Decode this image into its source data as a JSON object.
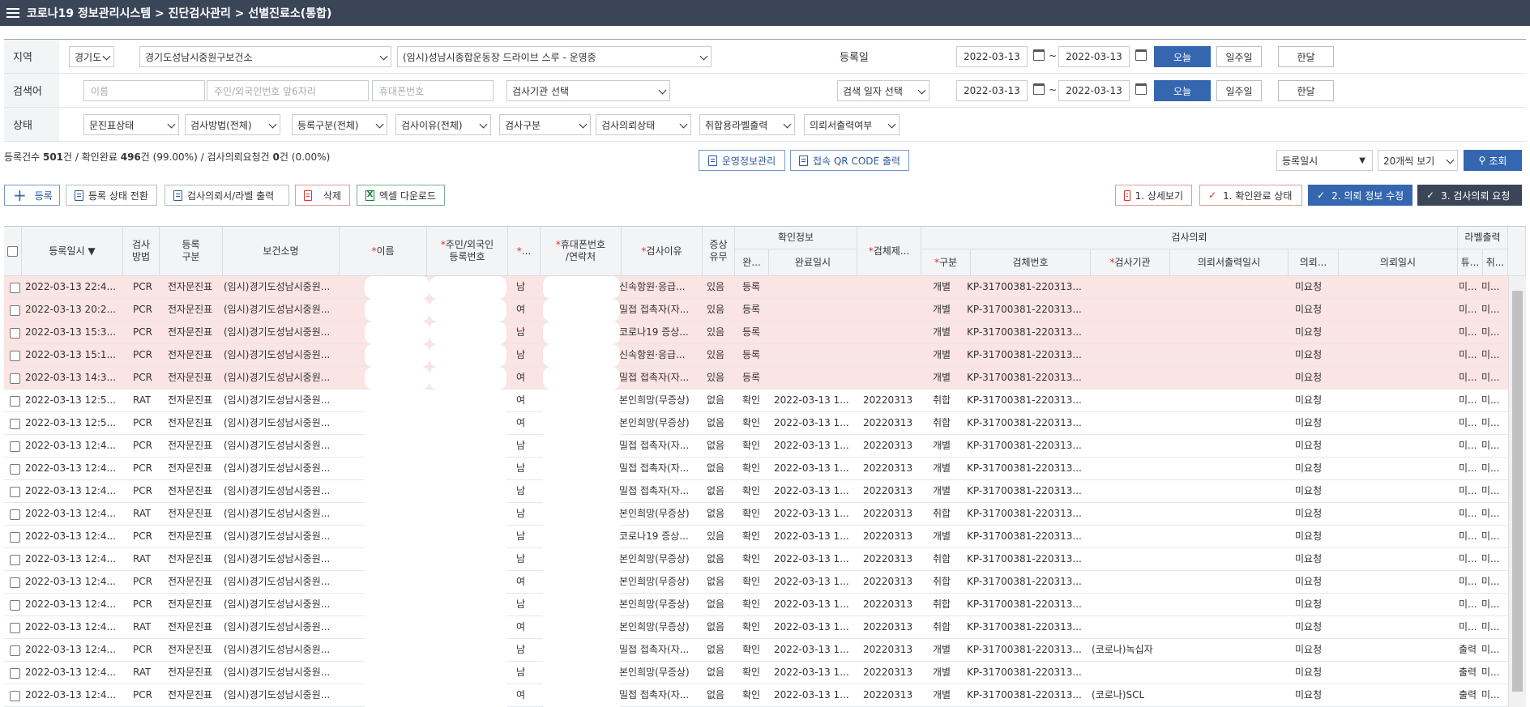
{
  "header": {
    "title": "코로나19 정보관리시스템 > 진단검사관리 > 선별진료소(통합)"
  },
  "filters": {
    "region_label": "지역",
    "province": "경기도",
    "health_center": "경기도성남시중원구보건소",
    "clinic": "(임시)성남시종합운동장 드라이브 스루 - 운영중",
    "reg_date_label": "등록일",
    "reg_date_from": "2022-03-13",
    "reg_date_to": "2022-03-13",
    "today": "오늘",
    "week": "일주일",
    "month": "한달",
    "search_label": "검색어",
    "name_placeholder": "이름",
    "id_placeholder": "주민/외국인번호 앞6자리",
    "phone_placeholder": "휴대폰번호",
    "lab_select": "검사기관 선택",
    "search_date_select": "검색 일자 선택",
    "search_date_from": "2022-03-13",
    "search_date_to": "2022-03-13",
    "status_label": "상태",
    "status_selects": [
      "문진표상태",
      "검사방법(전체)",
      "등록구분(전체)",
      "검사이유(전체)",
      "검사구분",
      "검사의뢰상태",
      "취합용라벨출력",
      "의뢰서출력여부"
    ]
  },
  "summary": {
    "p1": "등록건수 ",
    "reg_count": "501",
    "p2": "건 / 확인완료 ",
    "confirmed": "496",
    "p3": "건 (99.00%) / 검사의뢰요청건 ",
    "requested": "0",
    "p4": "건 (0.00%)"
  },
  "actions": {
    "ops_info": "운영정보관리",
    "qr_print": "접속 QR CODE 출력",
    "sort_select": "등록일시",
    "page_size_select": "20개씩 보기",
    "search_button": "조회",
    "register": "등록",
    "status_change": "등록 상태 전환",
    "print_label": "검사의뢰서/라벨 출력",
    "delete": "삭제",
    "excel": "엑셀 다운로드",
    "detail": "1. 상세보기",
    "confirm_status": "1. 확인완료 상태",
    "edit_request": "2. 의뢰 정보 수정",
    "request_test": "3. 검사의뢰 요청"
  },
  "table": {
    "group_headers": {
      "confirm": "확인정보",
      "request": "검사의뢰",
      "label": "라벨출력"
    },
    "headers": {
      "reg_time": "등록일시 ▼",
      "method": [
        "검사",
        "방법"
      ],
      "reg_type": [
        "등록",
        "구분"
      ],
      "center": "보건소명",
      "name": "이름",
      "rrn": [
        "주민/외국인",
        "등록번호"
      ],
      "sex": "...",
      "phone": [
        "휴대폰번호",
        "/연락처"
      ],
      "reason": "검사이유",
      "symptom": [
        "증상",
        "유무"
      ],
      "done": "완...",
      "done_time": "완료일시",
      "specimen": "검체제...",
      "type": "구분",
      "specimen_no": "검체번호",
      "lab": "검사기관",
      "print_time": "의뢰서출력일시",
      "req_status": "의뢰...",
      "req_time": "의뢰일시",
      "lbl1": "튜...",
      "lbl2": "취..."
    },
    "rows": [
      {
        "time": "2022-03-13 22:4...",
        "method": "PCR",
        "type": "전자문진표",
        "center": "(임시)경기도성남시중원...",
        "sex": "남",
        "reason": "신속항원·응급...",
        "symptom": "있음",
        "confirm": "등록",
        "done_time": "",
        "specimen": "",
        "group": "개별",
        "spec_no": "KP-31700381-220313...",
        "lab": "",
        "req": "미요청",
        "l1": "미...",
        "l2": "미...",
        "pending": true
      },
      {
        "time": "2022-03-13 20:2...",
        "method": "PCR",
        "type": "전자문진표",
        "center": "(임시)경기도성남시중원...",
        "sex": "여",
        "reason": "밀접 접촉자(자...",
        "symptom": "있음",
        "confirm": "등록",
        "done_time": "",
        "specimen": "",
        "group": "개별",
        "spec_no": "KP-31700381-220313...",
        "lab": "",
        "req": "미요청",
        "l1": "미...",
        "l2": "미...",
        "pending": true
      },
      {
        "time": "2022-03-13 15:3...",
        "method": "PCR",
        "type": "전자문진표",
        "center": "(임시)경기도성남시중원...",
        "sex": "남",
        "reason": "코로나19 증상...",
        "symptom": "있음",
        "confirm": "등록",
        "done_time": "",
        "specimen": "",
        "group": "개별",
        "spec_no": "KP-31700381-220313...",
        "lab": "",
        "req": "미요청",
        "l1": "미...",
        "l2": "미...",
        "pending": true
      },
      {
        "time": "2022-03-13 15:1...",
        "method": "PCR",
        "type": "전자문진표",
        "center": "(임시)경기도성남시중원...",
        "sex": "남",
        "reason": "신속항원·응급...",
        "symptom": "있음",
        "confirm": "등록",
        "done_time": "",
        "specimen": "",
        "group": "개별",
        "spec_no": "KP-31700381-220313...",
        "lab": "",
        "req": "미요청",
        "l1": "미...",
        "l2": "미...",
        "pending": true
      },
      {
        "time": "2022-03-13 14:3...",
        "method": "PCR",
        "type": "전자문진표",
        "center": "(임시)경기도성남시중원...",
        "sex": "여",
        "reason": "밀접 접촉자(자...",
        "symptom": "있음",
        "confirm": "등록",
        "done_time": "",
        "specimen": "",
        "group": "개별",
        "spec_no": "KP-31700381-220313...",
        "lab": "",
        "req": "미요청",
        "l1": "미...",
        "l2": "미...",
        "pending": true
      },
      {
        "time": "2022-03-13 12:5...",
        "method": "RAT",
        "type": "전자문진표",
        "center": "(임시)경기도성남시중원...",
        "sex": "여",
        "reason": "본인희망(무증상)",
        "symptom": "없음",
        "confirm": "확인",
        "done_time": "2022-03-13 1...",
        "specimen": "20220313",
        "group": "취합",
        "spec_no": "KP-31700381-220313...",
        "lab": "",
        "req": "미요청",
        "l1": "미...",
        "l2": "미...",
        "pending": false
      },
      {
        "time": "2022-03-13 12:5...",
        "method": "PCR",
        "type": "전자문진표",
        "center": "(임시)경기도성남시중원...",
        "sex": "여",
        "reason": "본인희망(무증상)",
        "symptom": "없음",
        "confirm": "확인",
        "done_time": "2022-03-13 1...",
        "specimen": "20220313",
        "group": "취합",
        "spec_no": "KP-31700381-220313...",
        "lab": "",
        "req": "미요청",
        "l1": "미...",
        "l2": "미...",
        "pending": false
      },
      {
        "time": "2022-03-13 12:4...",
        "method": "PCR",
        "type": "전자문진표",
        "center": "(임시)경기도성남시중원...",
        "sex": "남",
        "reason": "밀접 접촉자(자...",
        "symptom": "없음",
        "confirm": "확인",
        "done_time": "2022-03-13 1...",
        "specimen": "20220313",
        "group": "개별",
        "spec_no": "KP-31700381-220313...",
        "lab": "",
        "req": "미요청",
        "l1": "미...",
        "l2": "미...",
        "pending": false
      },
      {
        "time": "2022-03-13 12:4...",
        "method": "PCR",
        "type": "전자문진표",
        "center": "(임시)경기도성남시중원...",
        "sex": "남",
        "reason": "밀접 접촉자(자...",
        "symptom": "없음",
        "confirm": "확인",
        "done_time": "2022-03-13 1...",
        "specimen": "20220313",
        "group": "개별",
        "spec_no": "KP-31700381-220313...",
        "lab": "",
        "req": "미요청",
        "l1": "미...",
        "l2": "미...",
        "pending": false
      },
      {
        "time": "2022-03-13 12:4...",
        "method": "PCR",
        "type": "전자문진표",
        "center": "(임시)경기도성남시중원...",
        "sex": "남",
        "reason": "밀접 접촉자(자...",
        "symptom": "없음",
        "confirm": "확인",
        "done_time": "2022-03-13 1...",
        "specimen": "20220313",
        "group": "개별",
        "spec_no": "KP-31700381-220313...",
        "lab": "",
        "req": "미요청",
        "l1": "미...",
        "l2": "미...",
        "pending": false
      },
      {
        "time": "2022-03-13 12:4...",
        "method": "RAT",
        "type": "전자문진표",
        "center": "(임시)경기도성남시중원...",
        "sex": "남",
        "reason": "본인희망(무증상)",
        "symptom": "없음",
        "confirm": "확인",
        "done_time": "2022-03-13 1...",
        "specimen": "20220313",
        "group": "취합",
        "spec_no": "KP-31700381-220313...",
        "lab": "",
        "req": "미요청",
        "l1": "미...",
        "l2": "미...",
        "pending": false
      },
      {
        "time": "2022-03-13 12:4...",
        "method": "PCR",
        "type": "전자문진표",
        "center": "(임시)경기도성남시중원...",
        "sex": "남",
        "reason": "코로나19 증상...",
        "symptom": "있음",
        "confirm": "확인",
        "done_time": "2022-03-13 1...",
        "specimen": "20220313",
        "group": "개별",
        "spec_no": "KP-31700381-220313...",
        "lab": "",
        "req": "미요청",
        "l1": "미...",
        "l2": "미...",
        "pending": false
      },
      {
        "time": "2022-03-13 12:4...",
        "method": "RAT",
        "type": "전자문진표",
        "center": "(임시)경기도성남시중원...",
        "sex": "남",
        "reason": "본인희망(무증상)",
        "symptom": "없음",
        "confirm": "확인",
        "done_time": "2022-03-13 1...",
        "specimen": "20220313",
        "group": "취합",
        "spec_no": "KP-31700381-220313...",
        "lab": "",
        "req": "미요청",
        "l1": "미...",
        "l2": "미...",
        "pending": false
      },
      {
        "time": "2022-03-13 12:4...",
        "method": "PCR",
        "type": "전자문진표",
        "center": "(임시)경기도성남시중원...",
        "sex": "여",
        "reason": "본인희망(무증상)",
        "symptom": "없음",
        "confirm": "확인",
        "done_time": "2022-03-13 1...",
        "specimen": "20220313",
        "group": "취합",
        "spec_no": "KP-31700381-220313...",
        "lab": "",
        "req": "미요청",
        "l1": "미...",
        "l2": "미...",
        "pending": false
      },
      {
        "time": "2022-03-13 12:4...",
        "method": "PCR",
        "type": "전자문진표",
        "center": "(임시)경기도성남시중원...",
        "sex": "남",
        "reason": "본인희망(무증상)",
        "symptom": "없음",
        "confirm": "확인",
        "done_time": "2022-03-13 1...",
        "specimen": "20220313",
        "group": "취합",
        "spec_no": "KP-31700381-220313...",
        "lab": "",
        "req": "미요청",
        "l1": "미...",
        "l2": "미...",
        "pending": false
      },
      {
        "time": "2022-03-13 12:4...",
        "method": "RAT",
        "type": "전자문진표",
        "center": "(임시)경기도성남시중원...",
        "sex": "여",
        "reason": "본인희망(무증상)",
        "symptom": "없음",
        "confirm": "확인",
        "done_time": "2022-03-13 1...",
        "specimen": "20220313",
        "group": "취합",
        "spec_no": "KP-31700381-220313...",
        "lab": "",
        "req": "미요청",
        "l1": "미...",
        "l2": "미...",
        "pending": false
      },
      {
        "time": "2022-03-13 12:4...",
        "method": "PCR",
        "type": "전자문진표",
        "center": "(임시)경기도성남시중원...",
        "sex": "남",
        "reason": "밀접 접촉자(자...",
        "symptom": "없음",
        "confirm": "확인",
        "done_time": "2022-03-13 1...",
        "specimen": "20220313",
        "group": "개별",
        "spec_no": "KP-31700381-220313...",
        "lab": "(코로나)녹십자",
        "req": "미요청",
        "l1": "출력",
        "l2": "미...",
        "pending": false
      },
      {
        "time": "2022-03-13 12:4...",
        "method": "RAT",
        "type": "전자문진표",
        "center": "(임시)경기도성남시중원...",
        "sex": "남",
        "reason": "본인희망(무증상)",
        "symptom": "없음",
        "confirm": "확인",
        "done_time": "2022-03-13 1...",
        "specimen": "20220313",
        "group": "개별",
        "spec_no": "KP-31700381-220313...",
        "lab": "",
        "req": "미요청",
        "l1": "출력",
        "l2": "미...",
        "pending": false
      },
      {
        "time": "2022-03-13 12:4...",
        "method": "PCR",
        "type": "전자문진표",
        "center": "(임시)경기도성남시중원...",
        "sex": "여",
        "reason": "밀접 접촉자(자...",
        "symptom": "없음",
        "confirm": "확인",
        "done_time": "2022-03-13 1...",
        "specimen": "20220313",
        "group": "개별",
        "spec_no": "KP-31700381-220313...",
        "lab": "(코로나)SCL",
        "req": "미요청",
        "l1": "출력",
        "l2": "미...",
        "pending": false
      }
    ]
  },
  "colors": {
    "header_bg": "#3a4658",
    "primary_blue": "#3566b0",
    "pending_row": "#fbe4e4",
    "required_star": "#e03030"
  }
}
